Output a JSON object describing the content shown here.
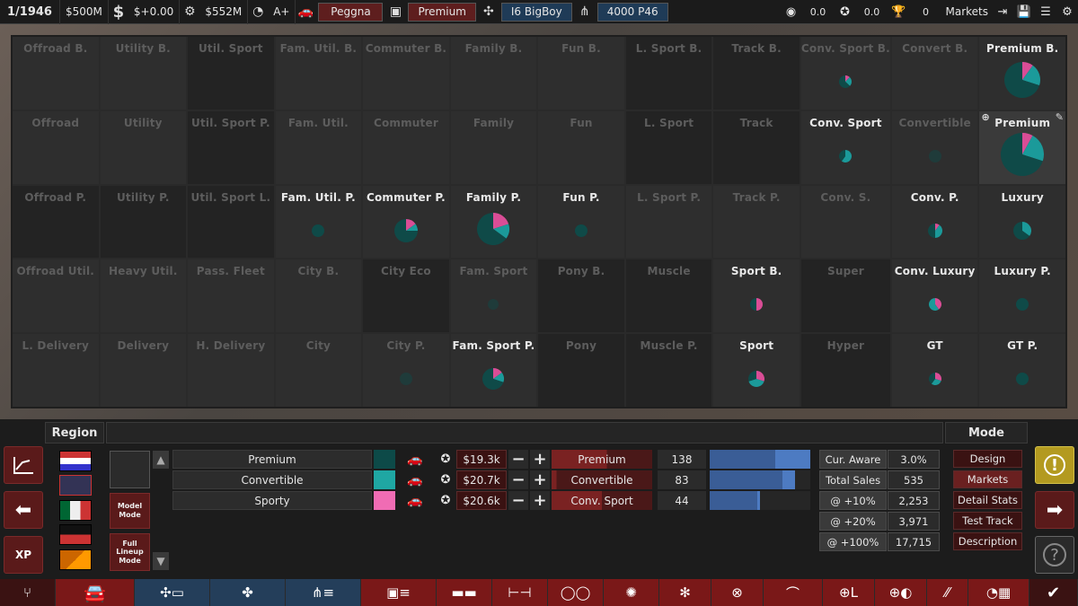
{
  "topbar": {
    "date": "1/1946",
    "money": "$500M",
    "income": "$+0.00",
    "assets": "$552M",
    "rating": "A+",
    "company": "Peggna",
    "trim": "Premium",
    "engine": "I6 BigBoy",
    "gearbox": "4000 P46",
    "val1": "0.0",
    "val2": "0.0",
    "trophies": "0",
    "markets_label": "Markets"
  },
  "segments": [
    {
      "label": "Offroad B.",
      "active": false,
      "dark": false,
      "pie": null
    },
    {
      "label": "Utility B.",
      "active": false,
      "dark": false,
      "pie": null
    },
    {
      "label": "Util. Sport",
      "active": false,
      "dark": true,
      "pie": null
    },
    {
      "label": "Fam. Util. B.",
      "active": false,
      "dark": false,
      "pie": null
    },
    {
      "label": "Commuter B.",
      "active": false,
      "dark": false,
      "pie": null
    },
    {
      "label": "Family B.",
      "active": false,
      "dark": false,
      "pie": null
    },
    {
      "label": "Fun B.",
      "active": false,
      "dark": false,
      "pie": null
    },
    {
      "label": "L. Sport B.",
      "active": false,
      "dark": true,
      "pie": null
    },
    {
      "label": "Track B.",
      "active": false,
      "dark": true,
      "pie": null
    },
    {
      "label": "Conv. Sport B.",
      "active": false,
      "dark": false,
      "pie": {
        "r": 7,
        "s": [
          0.12,
          0.25,
          0.63
        ]
      }
    },
    {
      "label": "Convert B.",
      "active": false,
      "dark": false,
      "pie": null
    },
    {
      "label": "Premium B.",
      "active": true,
      "dark": false,
      "pie": {
        "r": 20,
        "s": [
          0.1,
          0.2,
          0.7
        ]
      }
    },
    {
      "label": "Offroad",
      "active": false,
      "dark": false,
      "pie": null
    },
    {
      "label": "Utility",
      "active": false,
      "dark": false,
      "pie": null
    },
    {
      "label": "Util. Sport P.",
      "active": false,
      "dark": true,
      "pie": null
    },
    {
      "label": "Fam. Util.",
      "active": false,
      "dark": false,
      "pie": null
    },
    {
      "label": "Commuter",
      "active": false,
      "dark": false,
      "pie": null
    },
    {
      "label": "Family",
      "active": false,
      "dark": false,
      "pie": null
    },
    {
      "label": "Fun",
      "active": false,
      "dark": false,
      "pie": null
    },
    {
      "label": "L. Sport",
      "active": false,
      "dark": true,
      "pie": null
    },
    {
      "label": "Track",
      "active": false,
      "dark": true,
      "pie": null
    },
    {
      "label": "Conv. Sport",
      "active": true,
      "dark": false,
      "pie": {
        "r": 7,
        "s": [
          0.0,
          0.6,
          0.4
        ]
      }
    },
    {
      "label": "Convertible",
      "active": false,
      "dark": false,
      "pie": {
        "r": 7,
        "s": [
          0.0,
          1.0,
          0.0
        ]
      }
    },
    {
      "label": "Premium",
      "active": true,
      "dark": false,
      "pie": {
        "r": 24,
        "s": [
          0.08,
          0.22,
          0.7
        ]
      }
    },
    {
      "label": "Offroad P.",
      "active": false,
      "dark": true,
      "pie": null
    },
    {
      "label": "Utility P.",
      "active": false,
      "dark": true,
      "pie": null
    },
    {
      "label": "Util. Sport L.",
      "active": false,
      "dark": true,
      "pie": null
    },
    {
      "label": "Fam. Util. P.",
      "active": true,
      "dark": false,
      "pie": {
        "r": 7,
        "s": [
          0.0,
          0.0,
          1.0
        ]
      }
    },
    {
      "label": "Commuter P.",
      "active": true,
      "dark": false,
      "pie": {
        "r": 13,
        "s": [
          0.15,
          0.1,
          0.75
        ]
      }
    },
    {
      "label": "Family P.",
      "active": true,
      "dark": false,
      "pie": {
        "r": 18,
        "s": [
          0.2,
          0.15,
          0.65
        ]
      }
    },
    {
      "label": "Fun P.",
      "active": true,
      "dark": false,
      "pie": {
        "r": 7,
        "s": [
          0.0,
          0.0,
          1.0
        ]
      }
    },
    {
      "label": "L. Sport P.",
      "active": false,
      "dark": false,
      "pie": null
    },
    {
      "label": "Track P.",
      "active": false,
      "dark": false,
      "pie": null
    },
    {
      "label": "Conv. S.",
      "active": false,
      "dark": false,
      "pie": null
    },
    {
      "label": "Conv. P.",
      "active": true,
      "dark": false,
      "pie": {
        "r": 8,
        "s": [
          0.1,
          0.4,
          0.5
        ]
      }
    },
    {
      "label": "Luxury",
      "active": true,
      "dark": false,
      "pie": {
        "r": 10,
        "s": [
          0.0,
          0.35,
          0.65
        ]
      }
    },
    {
      "label": "Offroad Util.",
      "active": false,
      "dark": false,
      "pie": null
    },
    {
      "label": "Heavy Util.",
      "active": false,
      "dark": false,
      "pie": null
    },
    {
      "label": "Pass. Fleet",
      "active": false,
      "dark": false,
      "pie": null
    },
    {
      "label": "City B.",
      "active": false,
      "dark": false,
      "pie": null
    },
    {
      "label": "City Eco",
      "active": false,
      "dark": true,
      "pie": null
    },
    {
      "label": "Fam. Sport",
      "active": false,
      "dark": false,
      "pie": {
        "r": 6,
        "s": [
          0.0,
          0.0,
          1.0
        ]
      }
    },
    {
      "label": "Pony B.",
      "active": false,
      "dark": true,
      "pie": null
    },
    {
      "label": "Muscle",
      "active": false,
      "dark": true,
      "pie": null
    },
    {
      "label": "Sport B.",
      "active": true,
      "dark": false,
      "pie": {
        "r": 7,
        "s": [
          0.5,
          0.0,
          0.5
        ]
      }
    },
    {
      "label": "Super",
      "active": false,
      "dark": true,
      "pie": null
    },
    {
      "label": "Conv. Luxury",
      "active": true,
      "dark": false,
      "pie": {
        "r": 7,
        "s": [
          0.4,
          0.6,
          0.0
        ]
      }
    },
    {
      "label": "Luxury P.",
      "active": true,
      "dark": false,
      "pie": {
        "r": 7,
        "s": [
          0.0,
          0.0,
          1.0
        ]
      }
    },
    {
      "label": "L. Delivery",
      "active": false,
      "dark": false,
      "pie": null
    },
    {
      "label": "Delivery",
      "active": false,
      "dark": false,
      "pie": null
    },
    {
      "label": "H. Delivery",
      "active": false,
      "dark": false,
      "pie": null
    },
    {
      "label": "City",
      "active": false,
      "dark": false,
      "pie": null
    },
    {
      "label": "City P.",
      "active": false,
      "dark": false,
      "pie": {
        "r": 7,
        "s": [
          0.0,
          0.0,
          1.0
        ]
      }
    },
    {
      "label": "Fam. Sport P.",
      "active": true,
      "dark": false,
      "pie": {
        "r": 12,
        "s": [
          0.15,
          0.15,
          0.7
        ]
      }
    },
    {
      "label": "Pony",
      "active": false,
      "dark": true,
      "pie": null
    },
    {
      "label": "Muscle P.",
      "active": false,
      "dark": true,
      "pie": null
    },
    {
      "label": "Sport",
      "active": true,
      "dark": false,
      "pie": {
        "r": 9,
        "s": [
          0.3,
          0.4,
          0.3
        ]
      }
    },
    {
      "label": "Hyper",
      "active": false,
      "dark": true,
      "pie": null
    },
    {
      "label": "GT",
      "active": true,
      "dark": false,
      "pie": {
        "r": 7,
        "s": [
          0.3,
          0.3,
          0.4
        ]
      }
    },
    {
      "label": "GT P.",
      "active": true,
      "dark": false,
      "pie": {
        "r": 7,
        "s": [
          0.0,
          0.0,
          1.0
        ]
      }
    }
  ],
  "colors": {
    "pink": "#d94d96",
    "teal": "#1b9a9a",
    "dark_teal": "#0f4a48"
  },
  "region": {
    "title": "Region"
  },
  "modes": {
    "model_mode": "Model Mode",
    "full_lineup_mode": "Full Lineup Mode"
  },
  "models": [
    {
      "name": "Premium",
      "color": "#0d4a48",
      "price": "$19.3k",
      "segment": "Premium",
      "seg_fill": 0.55,
      "sales": "138",
      "bar": 0.65,
      "bar2": 0.35
    },
    {
      "name": "Convertible",
      "color": "#1fa7a3",
      "price": "$20.7k",
      "segment": "Convertible",
      "seg_fill": 0.05,
      "sales": "83",
      "bar": 0.72,
      "bar2": 0.13
    },
    {
      "name": "Sporty",
      "color": "#f06cb4",
      "price": "$20.6k",
      "segment": "Conv. Sport",
      "seg_fill": 0.5,
      "sales": "44",
      "bar": 0.47,
      "bar2": 0.03
    }
  ],
  "stats": [
    {
      "k": "Cur. Aware",
      "v": "3.0%"
    },
    {
      "k": "Total Sales",
      "v": "535"
    },
    {
      "k": "@ +10%",
      "v": "2,253"
    },
    {
      "k": "@ +20%",
      "v": "3,971"
    },
    {
      "k": "@ +100%",
      "v": "17,715"
    }
  ],
  "mode_panel": {
    "title": "Mode",
    "buttons": [
      "Design",
      "Markets",
      "Detail Stats",
      "Test Track",
      "Description"
    ]
  }
}
